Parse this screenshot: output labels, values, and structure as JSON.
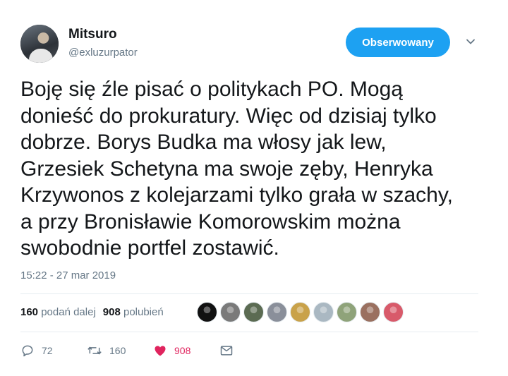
{
  "user": {
    "name": "Mitsuro",
    "handle": "@exluzurpator",
    "follow_label": "Obserwowany"
  },
  "tweet": {
    "lines": [
      "Boję się źle pisać o politykach PO. Mogą",
      "donieść do prokuratury. Więc od dzisiaj tylko",
      "dobrze. Borys Budka ma włosy jak lew,",
      "Grzesiek Schetyna ma swoje zęby, Henryka",
      "Krzywonos z kolejarzami tylko grała w szachy,",
      "a przy Bronisławie Komorowskim można",
      "swobodnie portfel zostawić."
    ],
    "timestamp": "15:22 - 27 mar 2019"
  },
  "stats": {
    "retweets_count": "160",
    "retweets_label": "podań dalej",
    "likes_count": "908",
    "likes_label": "polubień"
  },
  "likers": [
    {
      "color": "#111111"
    },
    {
      "color": "#7a7a7a"
    },
    {
      "color": "#5b6b52"
    },
    {
      "color": "#8a8f9a"
    },
    {
      "color": "#c9a24a"
    },
    {
      "color": "#aab8c2"
    },
    {
      "color": "#8fa37a"
    },
    {
      "color": "#9a7060"
    },
    {
      "color": "#d85a6a"
    }
  ],
  "actions": {
    "reply_count": "72",
    "retweet_count": "160",
    "like_count": "908"
  },
  "colors": {
    "accent": "#1da1f2",
    "like": "#e0245e",
    "muted": "#657786"
  }
}
